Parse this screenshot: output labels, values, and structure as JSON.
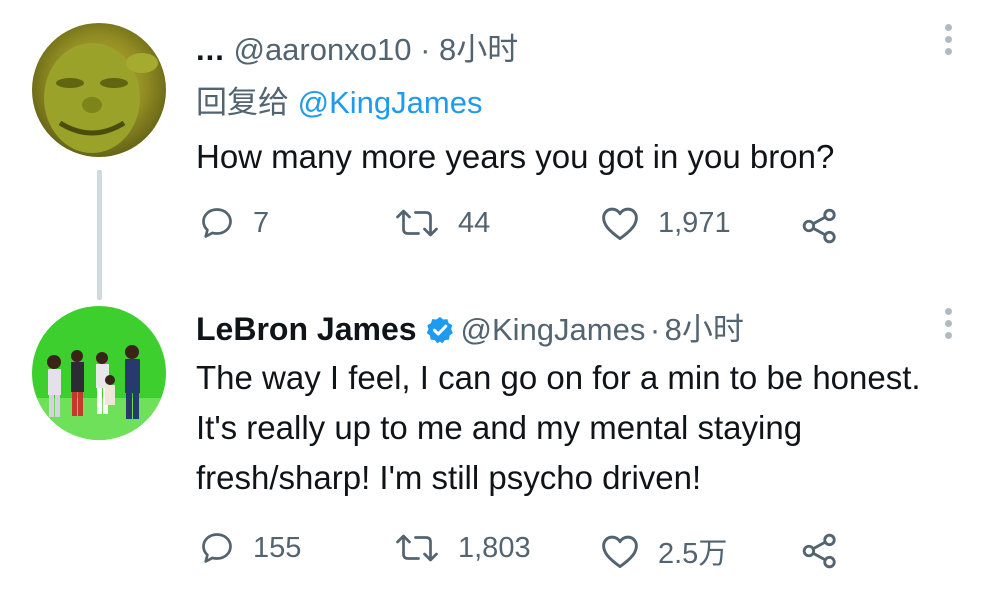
{
  "reply_tweet": {
    "ellipsis": "...",
    "handle": "@aaronxo10",
    "separator": "·",
    "time": "8小时",
    "reply_prefix": "回复给",
    "reply_mention": "@KingJames",
    "text": "How many more years you got in you bron?",
    "replies": "7",
    "retweets": "44",
    "likes": "1,971"
  },
  "main_tweet": {
    "name": "LeBron James",
    "handle": "@KingJames",
    "separator": "·",
    "time": "8小时",
    "text": "The way I feel, I can go on for a min to be honest. It's really up to me and my mental staying fresh/sharp! I'm still psycho driven!",
    "replies": "155",
    "retweets": "1,803",
    "likes": "2.5万"
  },
  "colors": {
    "accent": "#1d9bf0",
    "muted": "#536471",
    "thread_line": "#cfd9de"
  },
  "icons": {
    "reply": "speech-bubble-icon",
    "retweet": "retweet-icon",
    "like": "heart-icon",
    "share": "share-icon",
    "more": "vertical-dots-icon",
    "verified": "verified-badge-icon"
  }
}
